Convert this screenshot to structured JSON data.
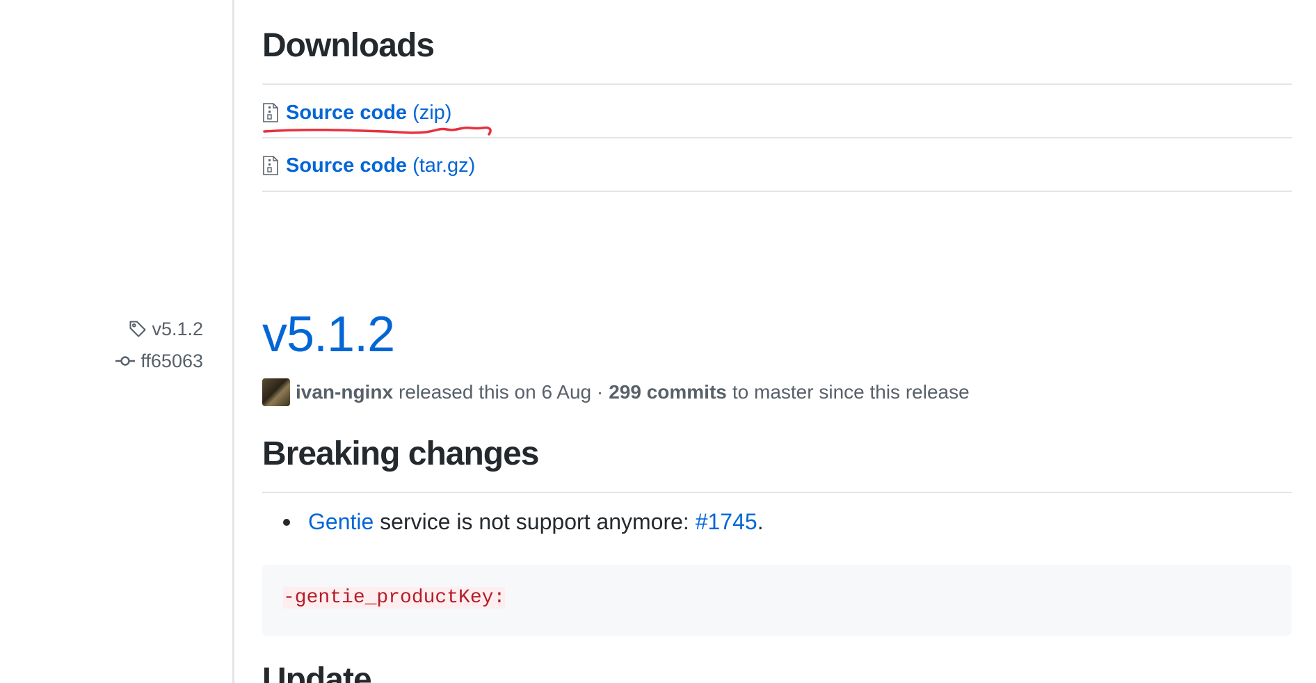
{
  "downloads": {
    "heading": "Downloads",
    "items": [
      {
        "label": "Source code",
        "ext": "(zip)",
        "icon": "file-zip-icon"
      },
      {
        "label": "Source code",
        "ext": "(tar.gz)",
        "icon": "file-zip-icon"
      }
    ],
    "annotation_color": "#e8303f"
  },
  "release": {
    "tag": "v5.1.2",
    "commit": "ff65063",
    "title": "v5.1.2",
    "author": "ivan-nginx",
    "released_text": "released this on 6 Aug ·",
    "commits_count": "299 commits",
    "since_text": "to master since this release"
  },
  "notes": {
    "heading": "Breaking changes",
    "bullet": {
      "link1": "Gentie",
      "text": "service is not support anymore:",
      "link2": "#1745",
      "end": "."
    },
    "code": "-gentie_productKey:",
    "next_heading": "Update"
  },
  "colors": {
    "link": "#0366d6",
    "text": "#24292e",
    "muted": "#586069",
    "border": "#e1e4e8"
  }
}
